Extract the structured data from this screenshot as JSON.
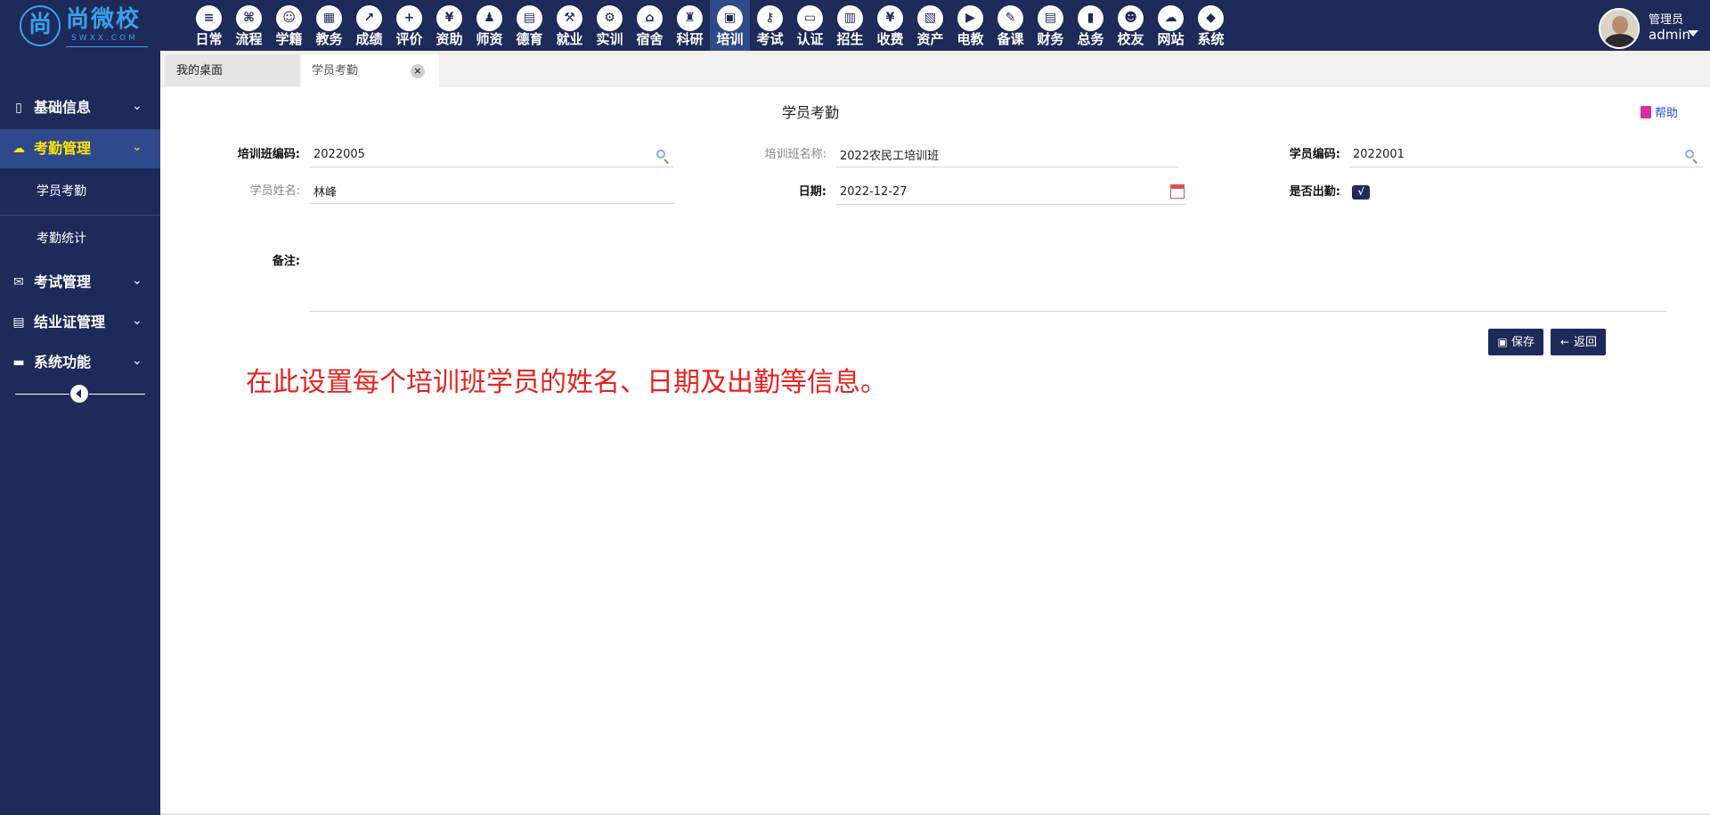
{
  "app": {
    "logo_text": "尚微校",
    "logo_sub": "SWXX.COM",
    "logo_mark": "尚"
  },
  "top_nav": [
    {
      "label": "日常",
      "icon": "document-icon",
      "glyph": "≡"
    },
    {
      "label": "流程",
      "icon": "flow-icon",
      "glyph": "⌘"
    },
    {
      "label": "学籍",
      "icon": "person-icon",
      "glyph": "☺"
    },
    {
      "label": "教务",
      "icon": "calendar-icon",
      "glyph": "▦"
    },
    {
      "label": "成绩",
      "icon": "trend-icon",
      "glyph": "↗"
    },
    {
      "label": "评价",
      "icon": "calendar-plus-icon",
      "glyph": "+"
    },
    {
      "label": "资助",
      "icon": "user-money-icon",
      "glyph": "¥"
    },
    {
      "label": "师资",
      "icon": "teacher-icon",
      "glyph": "♟"
    },
    {
      "label": "德育",
      "icon": "book-icon",
      "glyph": "▤"
    },
    {
      "label": "就业",
      "icon": "hammer-icon",
      "glyph": "⚒"
    },
    {
      "label": "实训",
      "icon": "robot-icon",
      "glyph": "⚙"
    },
    {
      "label": "宿舍",
      "icon": "home-icon",
      "glyph": "⌂"
    },
    {
      "label": "科研",
      "icon": "graduation-cap-icon",
      "glyph": "♜"
    },
    {
      "label": "培训",
      "icon": "image-icon",
      "glyph": "▣"
    },
    {
      "label": "考试",
      "icon": "key-icon",
      "glyph": "⚷"
    },
    {
      "label": "认证",
      "icon": "monitor-icon",
      "glyph": "▭"
    },
    {
      "label": "招生",
      "icon": "bus-icon",
      "glyph": "▥"
    },
    {
      "label": "收费",
      "icon": "yen-icon",
      "glyph": "¥"
    },
    {
      "label": "资产",
      "icon": "train-icon",
      "glyph": "▧"
    },
    {
      "label": "电教",
      "icon": "film-icon",
      "glyph": "▶"
    },
    {
      "label": "备课",
      "icon": "edit-icon",
      "glyph": "✎"
    },
    {
      "label": "财务",
      "icon": "newspaper-icon",
      "glyph": "▤"
    },
    {
      "label": "总务",
      "icon": "bar-chart-icon",
      "glyph": "▮"
    },
    {
      "label": "校友",
      "icon": "group-icon",
      "glyph": "☻"
    },
    {
      "label": "网站",
      "icon": "cloud-icon",
      "glyph": "☁"
    },
    {
      "label": "系统",
      "icon": "cube-icon",
      "glyph": "◆"
    }
  ],
  "top_nav_active_index": 13,
  "user": {
    "role": "管理员",
    "name": "admin"
  },
  "sidebar": {
    "groups": [
      {
        "label": "基础信息",
        "icon": "book-icon",
        "glyph": "▯"
      },
      {
        "label": "考勤管理",
        "icon": "cloud-icon",
        "glyph": "☁"
      },
      {
        "label": "考试管理",
        "icon": "envelope-icon",
        "glyph": "✉"
      },
      {
        "label": "结业证管理",
        "icon": "file-icon",
        "glyph": "▤"
      },
      {
        "label": "系统功能",
        "icon": "folder-icon",
        "glyph": "▬"
      }
    ],
    "submenu": [
      {
        "label": "学员考勤"
      },
      {
        "label": "考勤统计"
      }
    ],
    "chevron": "⌄"
  },
  "tabs": {
    "desktop": "我的桌面",
    "active": "学员考勤",
    "close_glyph": "×"
  },
  "page": {
    "title": "学员考勤",
    "help": "帮助"
  },
  "form": {
    "class_code_label": "培训班编码:",
    "class_code_value": "2022005",
    "class_name_label": "培训班名称:",
    "class_name_value": "2022农民工培训班",
    "student_code_label": "学员编码:",
    "student_code_value": "2022001",
    "student_name_label": "学员姓名:",
    "student_name_value": "林峰",
    "date_label": "日期:",
    "date_value": "2022-12-27",
    "attendance_label": "是否出勤:",
    "attendance_mark": "√",
    "remark_label": "备注:",
    "remark_value": ""
  },
  "buttons": {
    "save": "保存",
    "back": "返回",
    "save_glyph": "▣",
    "back_glyph": "←"
  },
  "instruction": "在此设置每个培训班学员的姓名、日期及出勤等信息。",
  "colors": {
    "brand": "#1d2a5a",
    "active": "#2f4a8c",
    "active_text": "#ffe600",
    "instruction": "#e8231f",
    "link": "#1a57d6"
  }
}
